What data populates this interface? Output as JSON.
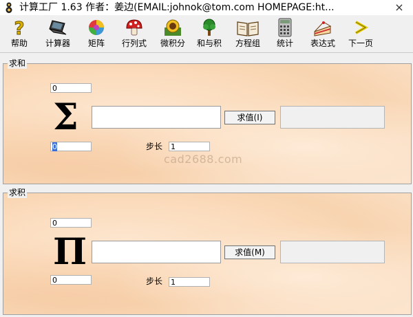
{
  "window": {
    "title": "计算工厂 1.63 作者：姜边(EMAIL:johnok@tom.com HOMEPAGE:ht...",
    "close_glyph": "×"
  },
  "toolbar": {
    "items": [
      {
        "id": "help",
        "label": "帮助",
        "icon": "question-icon"
      },
      {
        "id": "calculator",
        "label": "计算器",
        "icon": "laptop-icon"
      },
      {
        "id": "matrix",
        "label": "矩阵",
        "icon": "swirl-icon"
      },
      {
        "id": "determinant",
        "label": "行列式",
        "icon": "mushroom-icon"
      },
      {
        "id": "calculus",
        "label": "微积分",
        "icon": "sunflower-icon"
      },
      {
        "id": "sum-product",
        "label": "和与积",
        "icon": "tree-icon"
      },
      {
        "id": "equations",
        "label": "方程组",
        "icon": "book-icon"
      },
      {
        "id": "statistics",
        "label": "统计",
        "icon": "calculator-icon"
      },
      {
        "id": "expression",
        "label": "表达式",
        "icon": "cake-icon"
      },
      {
        "id": "next-page",
        "label": "下一页",
        "icon": "arrow-icon"
      }
    ]
  },
  "sum_panel": {
    "legend": "求和",
    "upper_value": "0",
    "symbol": "Σ",
    "button_label": "求值(I)",
    "lower_value": "0",
    "step_label": "步长",
    "step_value": "1"
  },
  "product_panel": {
    "legend": "求积",
    "upper_value": "0",
    "symbol": "Π",
    "button_label": "求值(M)",
    "lower_value": "0",
    "step_label": "步长",
    "step_value": "1"
  },
  "watermark": "cad2688.com",
  "colors": {
    "selection": "#3a6fd8",
    "panel_bg": "#fbdcbd"
  }
}
